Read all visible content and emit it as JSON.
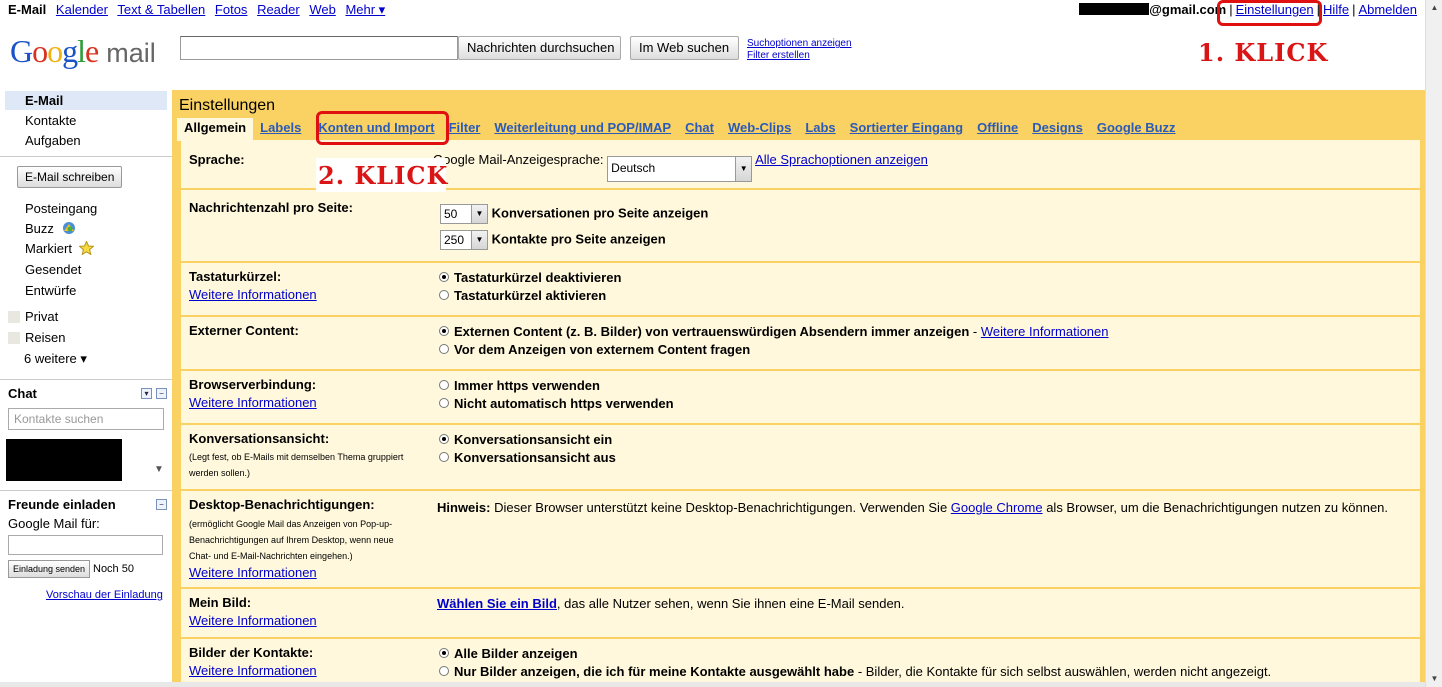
{
  "topbar": {
    "current": "E-Mail",
    "links": [
      "Kalender",
      "Text & Tabellen",
      "Fotos",
      "Reader",
      "Web",
      "Mehr ▾"
    ],
    "email_suffix": "@gmail.com",
    "settings": "Einstellungen",
    "help": "Hilfe",
    "logout": "Abmelden"
  },
  "logo": {
    "google": "Google",
    "mail": "mail"
  },
  "search": {
    "mail_button": "Nachrichten durchsuchen",
    "web_button": "Im Web suchen",
    "options_link": "Suchoptionen anzeigen",
    "filter_link": "Filter erstellen"
  },
  "annotations": {
    "step1": "1. KLICK",
    "step2": "2. KLICK",
    "accent_color": "#e01010"
  },
  "sidebar": {
    "top_items": [
      "E-Mail",
      "Kontakte",
      "Aufgaben"
    ],
    "compose": "E-Mail schreiben",
    "folders": [
      "Posteingang",
      "Buzz",
      "Markiert",
      "Gesendet",
      "Entwürfe"
    ],
    "labels": [
      "Privat",
      "Reisen"
    ],
    "more": "6 weitere ▾",
    "chat_title": "Chat",
    "chat_search_placeholder": "Kontakte suchen",
    "invite_title": "Freunde einladen",
    "invite_label": "Google Mail für:",
    "invite_button": "Einladung senden",
    "invite_remaining": "Noch 50",
    "invite_preview": "Vorschau der Einladung"
  },
  "settings": {
    "title": "Einstellungen",
    "tabs": [
      "Allgemein",
      "Labels",
      "Konten und Import",
      "Filter",
      "Weiterleitung und POP/IMAP",
      "Chat",
      "Web-Clips",
      "Labs",
      "Sortierter Eingang",
      "Offline",
      "Designs",
      "Google Buzz"
    ],
    "more_info": "Weitere Informationen",
    "language": {
      "label": "Sprache:",
      "text": "Google Mail-Anzeigesprache:",
      "value": "Deutsch",
      "link": "Alle Sprachoptionen anzeigen"
    },
    "page_size": {
      "label": "Nachrichtenzahl pro Seite:",
      "conv_value": "50",
      "conv_text": "Konversationen pro Seite anzeigen",
      "contacts_value": "250",
      "contacts_text": "Kontakte pro Seite anzeigen"
    },
    "shortcuts": {
      "label": "Tastaturkürzel:",
      "opt_off": "Tastaturkürzel deaktivieren",
      "opt_on": "Tastaturkürzel aktivieren"
    },
    "external": {
      "label": "Externer Content:",
      "opt_always": "Externen Content (z. B. Bilder) von vertrauenswürdigen Absendern immer anzeigen",
      "opt_ask": "Vor dem Anzeigen von externem Content fragen"
    },
    "browser": {
      "label": "Browserverbindung:",
      "opt_always": "Immer https verwenden",
      "opt_never": "Nicht automatisch https verwenden"
    },
    "conversation": {
      "label": "Konversationsansicht:",
      "sub1": "(Legt fest, ob E-Mails mit demselben Thema gruppiert",
      "sub2": "werden sollen.)",
      "opt_on": "Konversationsansicht ein",
      "opt_off": "Konversationsansicht aus"
    },
    "desktop": {
      "label": "Desktop-Benachrichtigungen:",
      "sub1": "(ermöglicht Google Mail das Anzeigen von Pop-up-",
      "sub2": "Benachrichtigungen auf Ihrem Desktop, wenn neue",
      "sub3": "Chat- und E-Mail-Nachrichten eingehen.)",
      "hint_label": "Hinweis:",
      "hint_text1": "Dieser Browser unterstützt keine Desktop-Benachrichtigungen. Verwenden Sie",
      "hint_link": "Google Chrome",
      "hint_text2": "als Browser, um die Benachrichtigungen nutzen zu können."
    },
    "picture": {
      "label": "Mein Bild:",
      "link": "Wählen Sie ein Bild",
      "text": ", das alle Nutzer sehen, wenn Sie ihnen eine E-Mail senden."
    },
    "contact_pics": {
      "label": "Bilder der Kontakte:",
      "opt_all": "Alle Bilder anzeigen",
      "opt_mine": "Nur Bilder anzeigen, die ich für meine Kontakte ausgewählt habe",
      "opt_mine_note": " - Bilder, die Kontakte für sich selbst auswählen, werden nicht angezeigt."
    }
  }
}
